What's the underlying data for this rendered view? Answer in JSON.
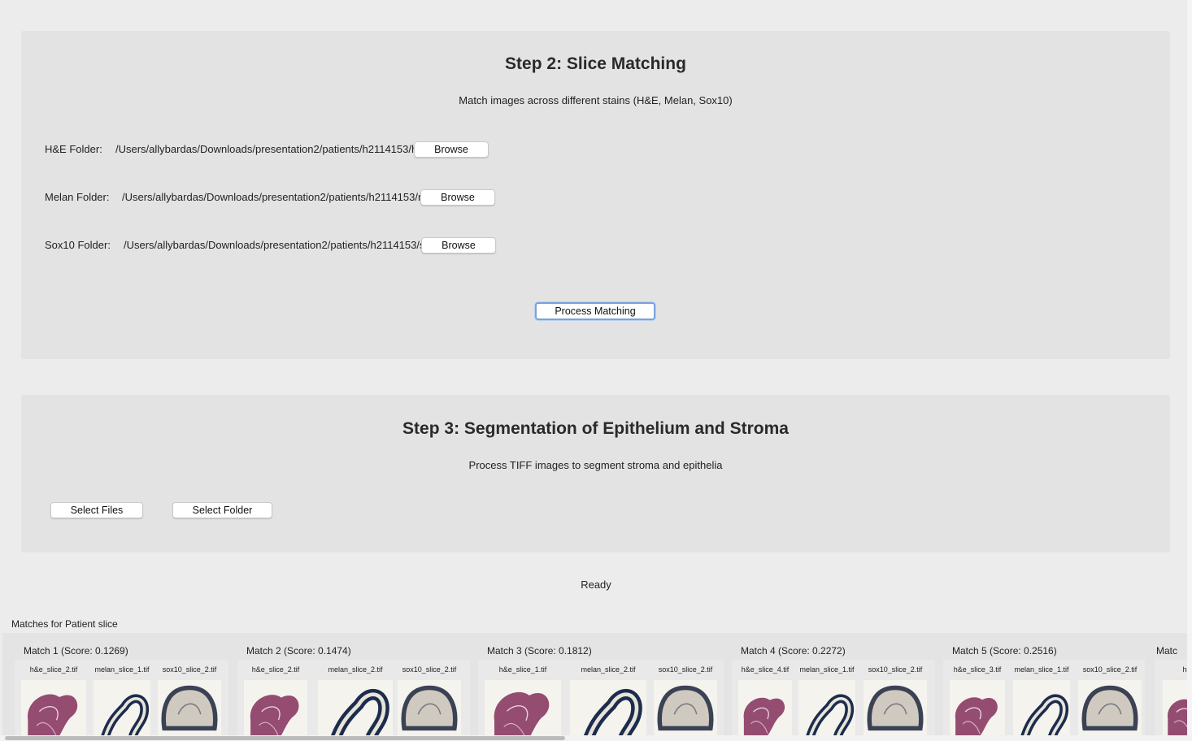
{
  "step2": {
    "title": "Step 2: Slice Matching",
    "subtitle": "Match images across different stains (H&E, Melan, Sox10)",
    "rows": [
      {
        "label": "H&E Folder:",
        "path": "/Users/allybardas/Downloads/presentation2/patients/h2114153/h",
        "button": "Browse"
      },
      {
        "label": "Melan Folder:",
        "path": "/Users/allybardas/Downloads/presentation2/patients/h2114153/n",
        "button": "Browse"
      },
      {
        "label": "Sox10 Folder:",
        "path": "/Users/allybardas/Downloads/presentation2/patients/h2114153/s",
        "button": "Browse"
      }
    ],
    "process_button": "Process Matching"
  },
  "step3": {
    "title": "Step 3: Segmentation of Epithelium and Stroma",
    "subtitle": "Process TIFF images to segment stroma and epithelia",
    "select_files": "Select Files",
    "select_folder": "Select Folder"
  },
  "status": "Ready",
  "matches": {
    "title": "Matches for Patient slice",
    "items": [
      {
        "title": "Match 1 (Score: 0.1269)",
        "files": [
          "h&e_slice_2.tif",
          "melan_slice_1.tif",
          "sox10_slice_2.tif"
        ]
      },
      {
        "title": "Match 2 (Score: 0.1474)",
        "files": [
          "h&e_slice_2.tif",
          "melan_slice_2.tif",
          "sox10_slice_2.tif"
        ]
      },
      {
        "title": "Match 3 (Score: 0.1812)",
        "files": [
          "h&e_slice_1.tif",
          "melan_slice_2.tif",
          "sox10_slice_2.tif"
        ]
      },
      {
        "title": "Match 4 (Score: 0.2272)",
        "files": [
          "h&e_slice_4.tif",
          "melan_slice_1.tif",
          "sox10_slice_2.tif"
        ]
      },
      {
        "title": "Match 5 (Score: 0.2516)",
        "files": [
          "h&e_slice_3.tif",
          "melan_slice_1.tif",
          "sox10_slice_2.tif"
        ]
      },
      {
        "title": "Matc",
        "files": [
          "h&"
        ]
      }
    ]
  },
  "colors": {
    "he_stain": "#8a3a62",
    "melan_stain": "#1c2c4c",
    "sox10_stain": "#3a4254",
    "focus_ring": "#7aa3dc"
  },
  "icons": {
    "he": "he-tissue-thumbnail",
    "melan": "melan-tissue-thumbnail",
    "sox10": "sox10-tissue-thumbnail"
  }
}
